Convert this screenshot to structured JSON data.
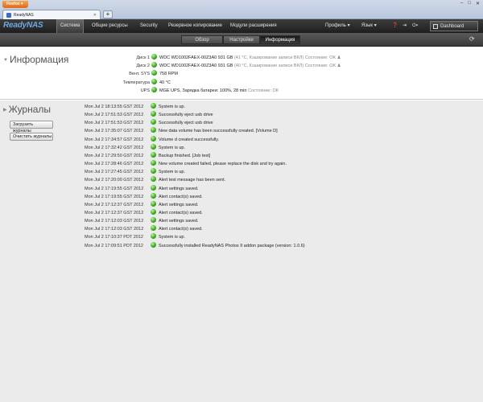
{
  "browser": {
    "app_button": "Firefox",
    "tab_title": "ReadyNAS",
    "new_tab": "+",
    "controls": [
      "–",
      "□",
      "✕"
    ]
  },
  "nav": {
    "logo": "ReadyNAS",
    "items": [
      "Система",
      "Общие ресурсы",
      "Security",
      "Резервное копирование",
      "Модули расширения"
    ],
    "profile": "Профиль ▾",
    "language": "Язык ▾",
    "dashboard": "Dashboard"
  },
  "subnav": {
    "tabs": [
      "Обзор",
      "Настройки",
      "Информация"
    ],
    "active_index": 2
  },
  "info": {
    "title": "Информация",
    "rows": [
      {
        "label": "Диск 1",
        "value": "WDC WD1002FAEX-00Z3A0 931 GB",
        "extra": "(41 °C, Кэширование записи ВКЛ) Состояние: OK",
        "has_dot": true
      },
      {
        "label": "Диск 2",
        "value": "WDC WD1002FAEX-00Z3A0 931 GB",
        "extra": "(40 °C, Кэширование записи ВКЛ) Состояние: OK",
        "has_dot": true
      },
      {
        "label": "Вент. SYS",
        "value": "758 RPM",
        "extra": "",
        "has_dot": true
      },
      {
        "label": "Температура",
        "value": "40 °C",
        "extra": "",
        "has_dot": true
      },
      {
        "label": "UPS",
        "value": "MGE UPS, Зарядка батареи: 100%, 28 min",
        "extra": "Состояние: OK",
        "has_dot": true
      }
    ]
  },
  "logs": {
    "title": "Журналы",
    "download_button": "Загрузить журналы",
    "clear_button": "Очистить журналы",
    "entries": [
      {
        "ts": "Mon Jul 2 18:13:55 GST 2012",
        "msg": "System is up."
      },
      {
        "ts": "Mon Jul 2 17:51:53 GST 2012",
        "msg": "Successfully eject usb drive"
      },
      {
        "ts": "Mon Jul 2 17:51:53 GST 2012",
        "msg": "Successfully eject usb drive"
      },
      {
        "ts": "Mon Jul 2 17:35:07 GST 2012",
        "msg": "New data volume has been successfully created. [Volume D]"
      },
      {
        "ts": "Mon Jul 2 17:34:57 GST 2012",
        "msg": "Volume d created successfully."
      },
      {
        "ts": "Mon Jul 2 17:32:42 GST 2012",
        "msg": "System is up."
      },
      {
        "ts": "Mon Jul 2 17:29:50 GST 2012",
        "msg": "Backup finished. [Job test]"
      },
      {
        "ts": "Mon Jul 2 17:28:46 GST 2012",
        "msg": "New volume created failed, please replace the disk and try again."
      },
      {
        "ts": "Mon Jul 2 17:27:45 GST 2012",
        "msg": "System is up."
      },
      {
        "ts": "Mon Jul 2 17:20:00 GST 2012",
        "msg": "Alert test message has been sent."
      },
      {
        "ts": "Mon Jul 2 17:19:55 GST 2012",
        "msg": "Alert settings saved."
      },
      {
        "ts": "Mon Jul 2 17:19:55 GST 2012",
        "msg": "Alert contact(s) saved."
      },
      {
        "ts": "Mon Jul 2 17:12:37 GST 2012",
        "msg": "Alert settings saved."
      },
      {
        "ts": "Mon Jul 2 17:12:37 GST 2012",
        "msg": "Alert contact(s) saved."
      },
      {
        "ts": "Mon Jul 2 17:12:03 GST 2012",
        "msg": "Alert settings saved."
      },
      {
        "ts": "Mon Jul 2 17:12:03 GST 2012",
        "msg": "Alert contact(s) saved."
      },
      {
        "ts": "Mon Jul 2 17:10:37 PDT 2012",
        "msg": "System is up."
      },
      {
        "ts": "Mon Jul 2 17:09:51 PDT 2012",
        "msg": "Successfully installed ReadyNAS Photos II addon package (version: 1.0.6)"
      }
    ]
  },
  "colors": {
    "status_ok": "#3aa51c",
    "app_bar": "#2a2a2a",
    "logo": "#6fa8e0"
  }
}
